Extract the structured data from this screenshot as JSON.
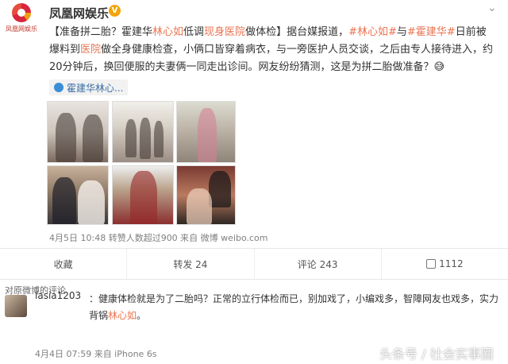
{
  "post": {
    "author_logo_text": "凤凰网娱乐",
    "author": "凤凰网娱乐",
    "verify_badge": "V",
    "text": {
      "p1": "【准备拼二胎？霍建华",
      "p2": "林心如",
      "p3": "低调",
      "p4": "现身医院",
      "p5": "做体检】据台媒报道，",
      "p6": "#林心如#",
      "p7": "与",
      "p8": "#霍建华#",
      "p9": "日前被爆料到",
      "p10": "医院",
      "p11": "做全身健康检查，小俩口皆穿着病衣，与一旁医护人员交谈，之后由专人接待进入，约20分钟后，换回便服的夫妻俩一同走出诊间。网友纷纷猜测，这是为拼二胎做准备？😅"
    },
    "link_card": "霍建华林心...",
    "meta": "4月5日 10:48  转赞人数超过900  来自 微博 weibo.com"
  },
  "actions": {
    "favorite": "收藏",
    "repost": "转发 24",
    "comment": "评论 243",
    "like": "1112"
  },
  "comments": {
    "header": "对原微博的评论",
    "items": [
      {
        "user": "lasia1203",
        "text_a": "：健康体检就是为了二胎吗？正常的立行体检而已，别加戏了，小编戏多，智障网友也戏多，实力背锅",
        "text_b": "林心如",
        "text_c": "。",
        "meta": "4月4日 07:59  来自 iPhone 6s"
      }
    ]
  },
  "watermark": "头条号 / 社会实事圈"
}
